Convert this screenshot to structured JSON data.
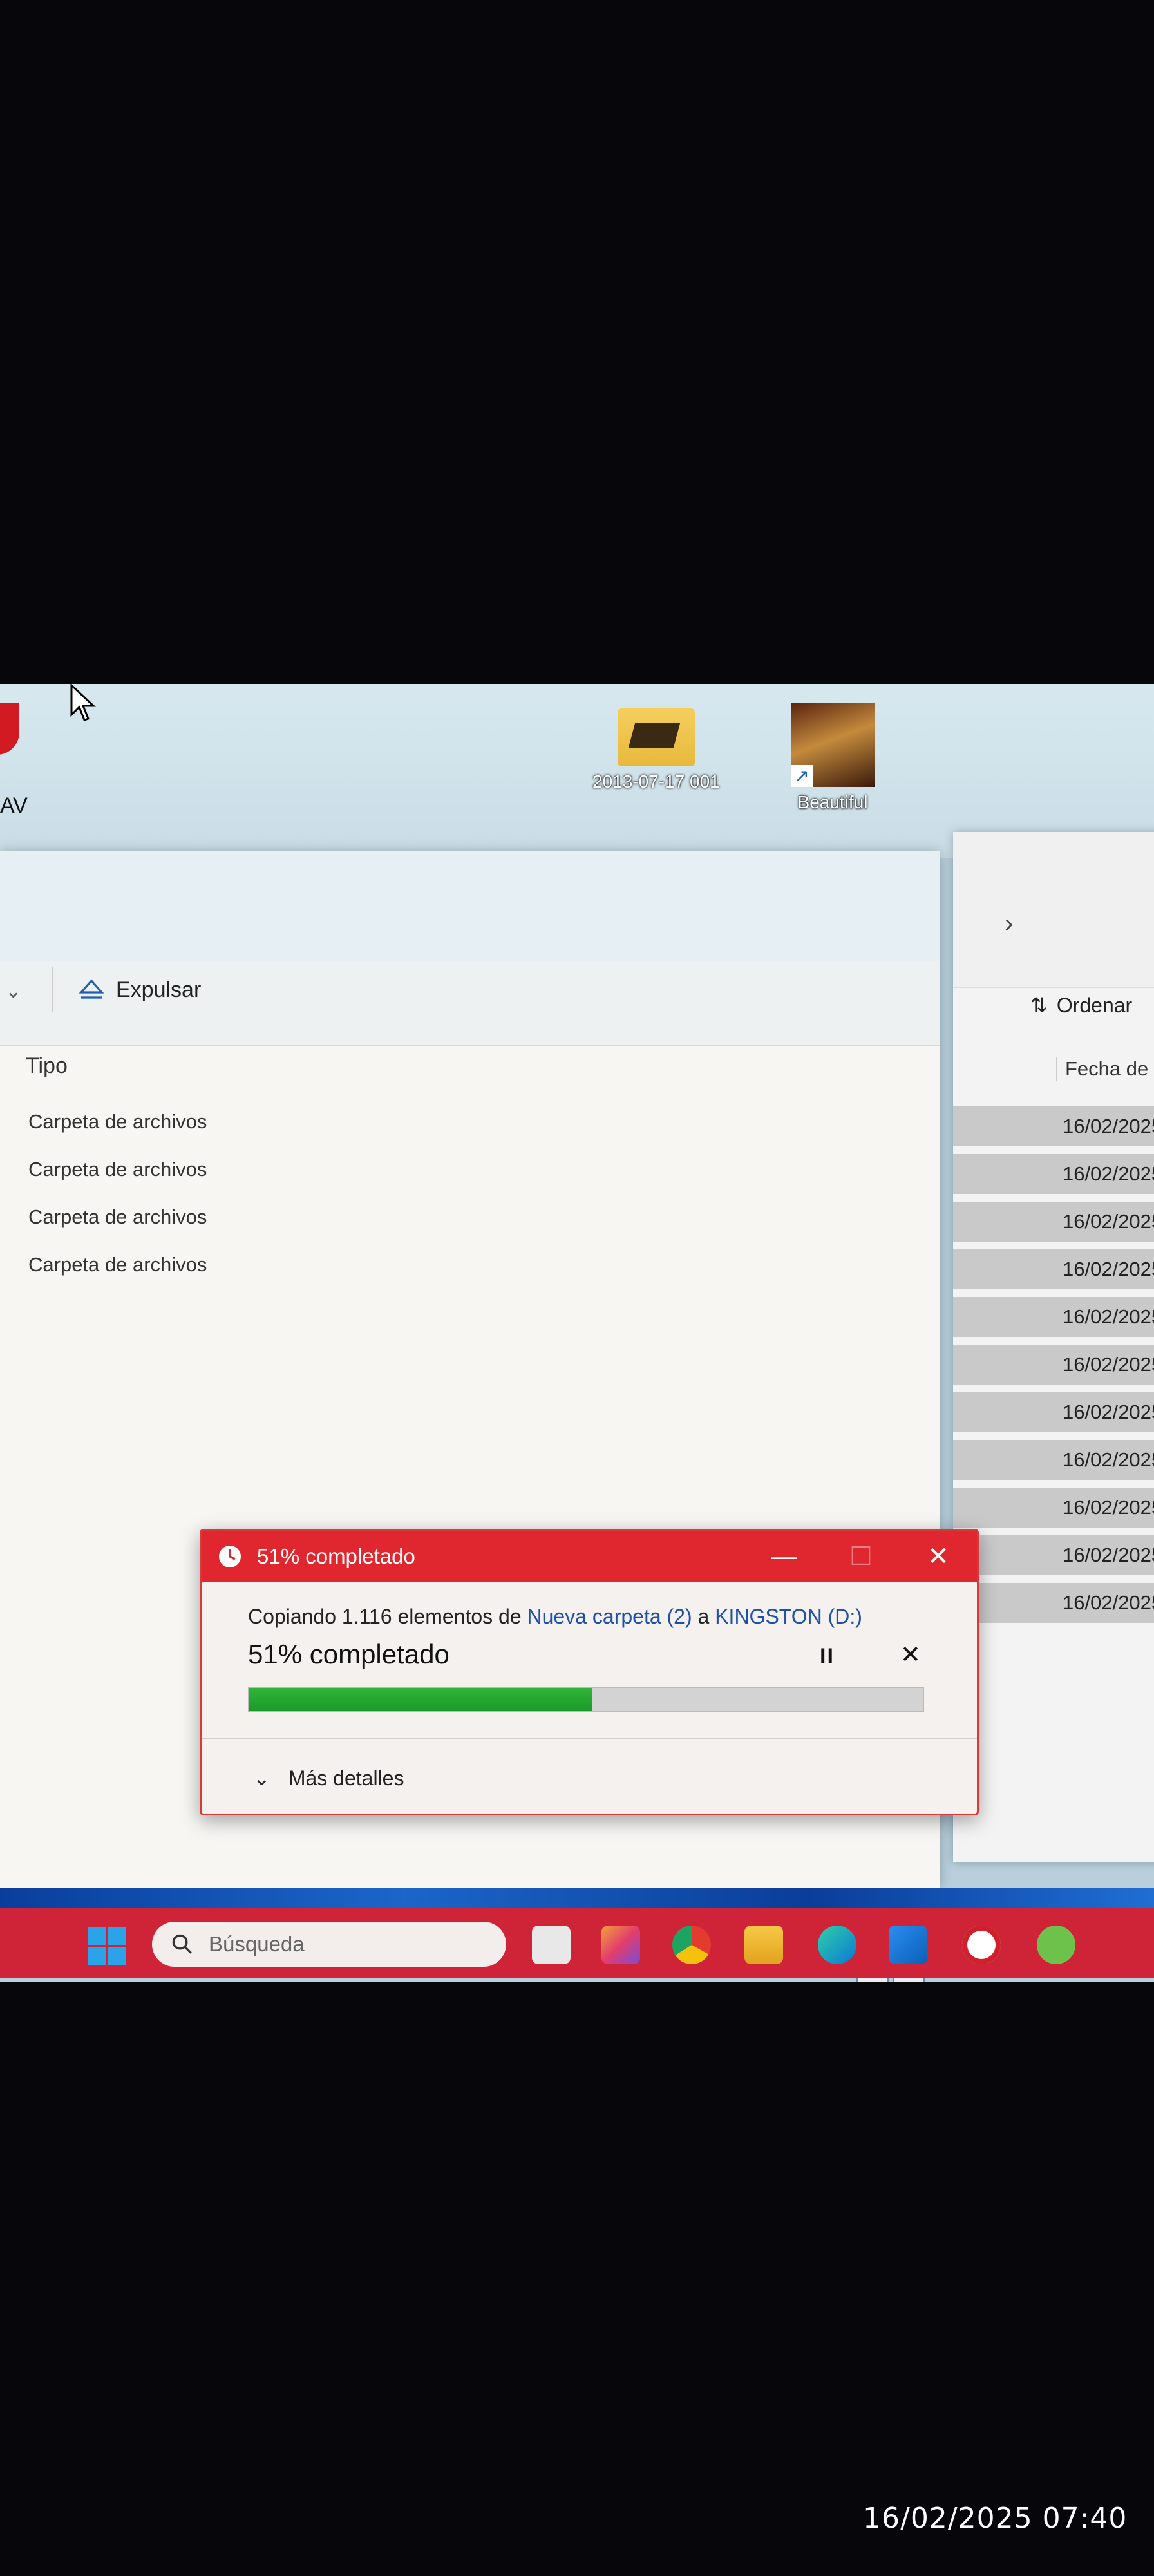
{
  "desktop": {
    "app_label": "AV",
    "items": [
      {
        "label": "2013-07-17 001",
        "icon": "folder-photo-icon"
      },
      {
        "label": "Beautiful",
        "icon": "image-shortcut-icon"
      }
    ]
  },
  "explorer": {
    "eject_label": "Expulsar",
    "type_header": "Tipo",
    "rows": [
      "Carpeta de archivos",
      "Carpeta de archivos",
      "Carpeta de archivos",
      "Carpeta de archivos"
    ],
    "sort_label": "Ordenar",
    "date_header": "Fecha de",
    "dates": [
      "16/02/2025",
      "16/02/2025",
      "16/02/2025",
      "16/02/2025",
      "16/02/2025",
      "16/02/2025",
      "16/02/2025",
      "16/02/2025",
      "16/02/2025",
      "16/02/2025",
      "16/02/2025"
    ]
  },
  "dialog": {
    "title": "51% completado",
    "copy_prefix": "Copiando 1.116 elementos de ",
    "source": "Nueva carpeta (2)",
    "copy_middle": " a ",
    "destination": "KINGSTON (D:)",
    "progress_label": "51% completado",
    "progress_fraction": 0.51,
    "more_details": "Más detalles",
    "accent_color": "#e0262e",
    "progress_color": "#1a9a2a"
  },
  "taskbar": {
    "search_placeholder": "Búsqueda",
    "apps": [
      "task-view-icon",
      "photos-icon",
      "chrome-icon",
      "file-explorer-icon",
      "edge-icon",
      "store-icon",
      "media-player-icon",
      "utorrent-icon"
    ],
    "color": "#cf2437"
  },
  "photo": {
    "timestamp": "16/02/2025 07:40"
  }
}
